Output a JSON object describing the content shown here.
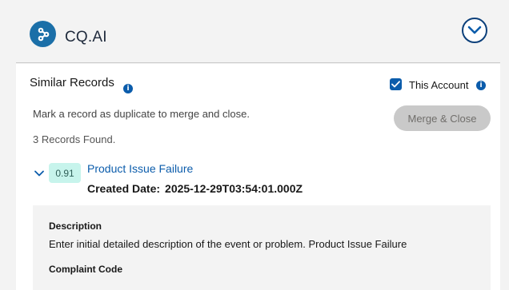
{
  "header": {
    "brand": "CQ.AI",
    "icons": {
      "logo": "cqai-logo-icon",
      "collapse": "chevron-down-circle-icon"
    }
  },
  "similar_records": {
    "title": "Similar Records",
    "this_account_label": "This Account",
    "this_account_checked": true,
    "hint": "Mark a record as duplicate to merge and close.",
    "merge_button": "Merge & Close",
    "records_found": "3 Records Found.",
    "records": [
      {
        "score": "0.91",
        "title": "Product Issue Failure",
        "created_label": "Created Date:",
        "created_value": "2025-12-29T03:54:01.000Z",
        "description_label": "Description",
        "description": "Enter initial detailed description of the event or problem. Product Issue Failure",
        "complaint_code_label": "Complaint Code"
      }
    ]
  },
  "colors": {
    "brand_blue": "#0b5cab",
    "score_bg": "#c7f4ec",
    "disabled_button": "#c9c9c9"
  }
}
